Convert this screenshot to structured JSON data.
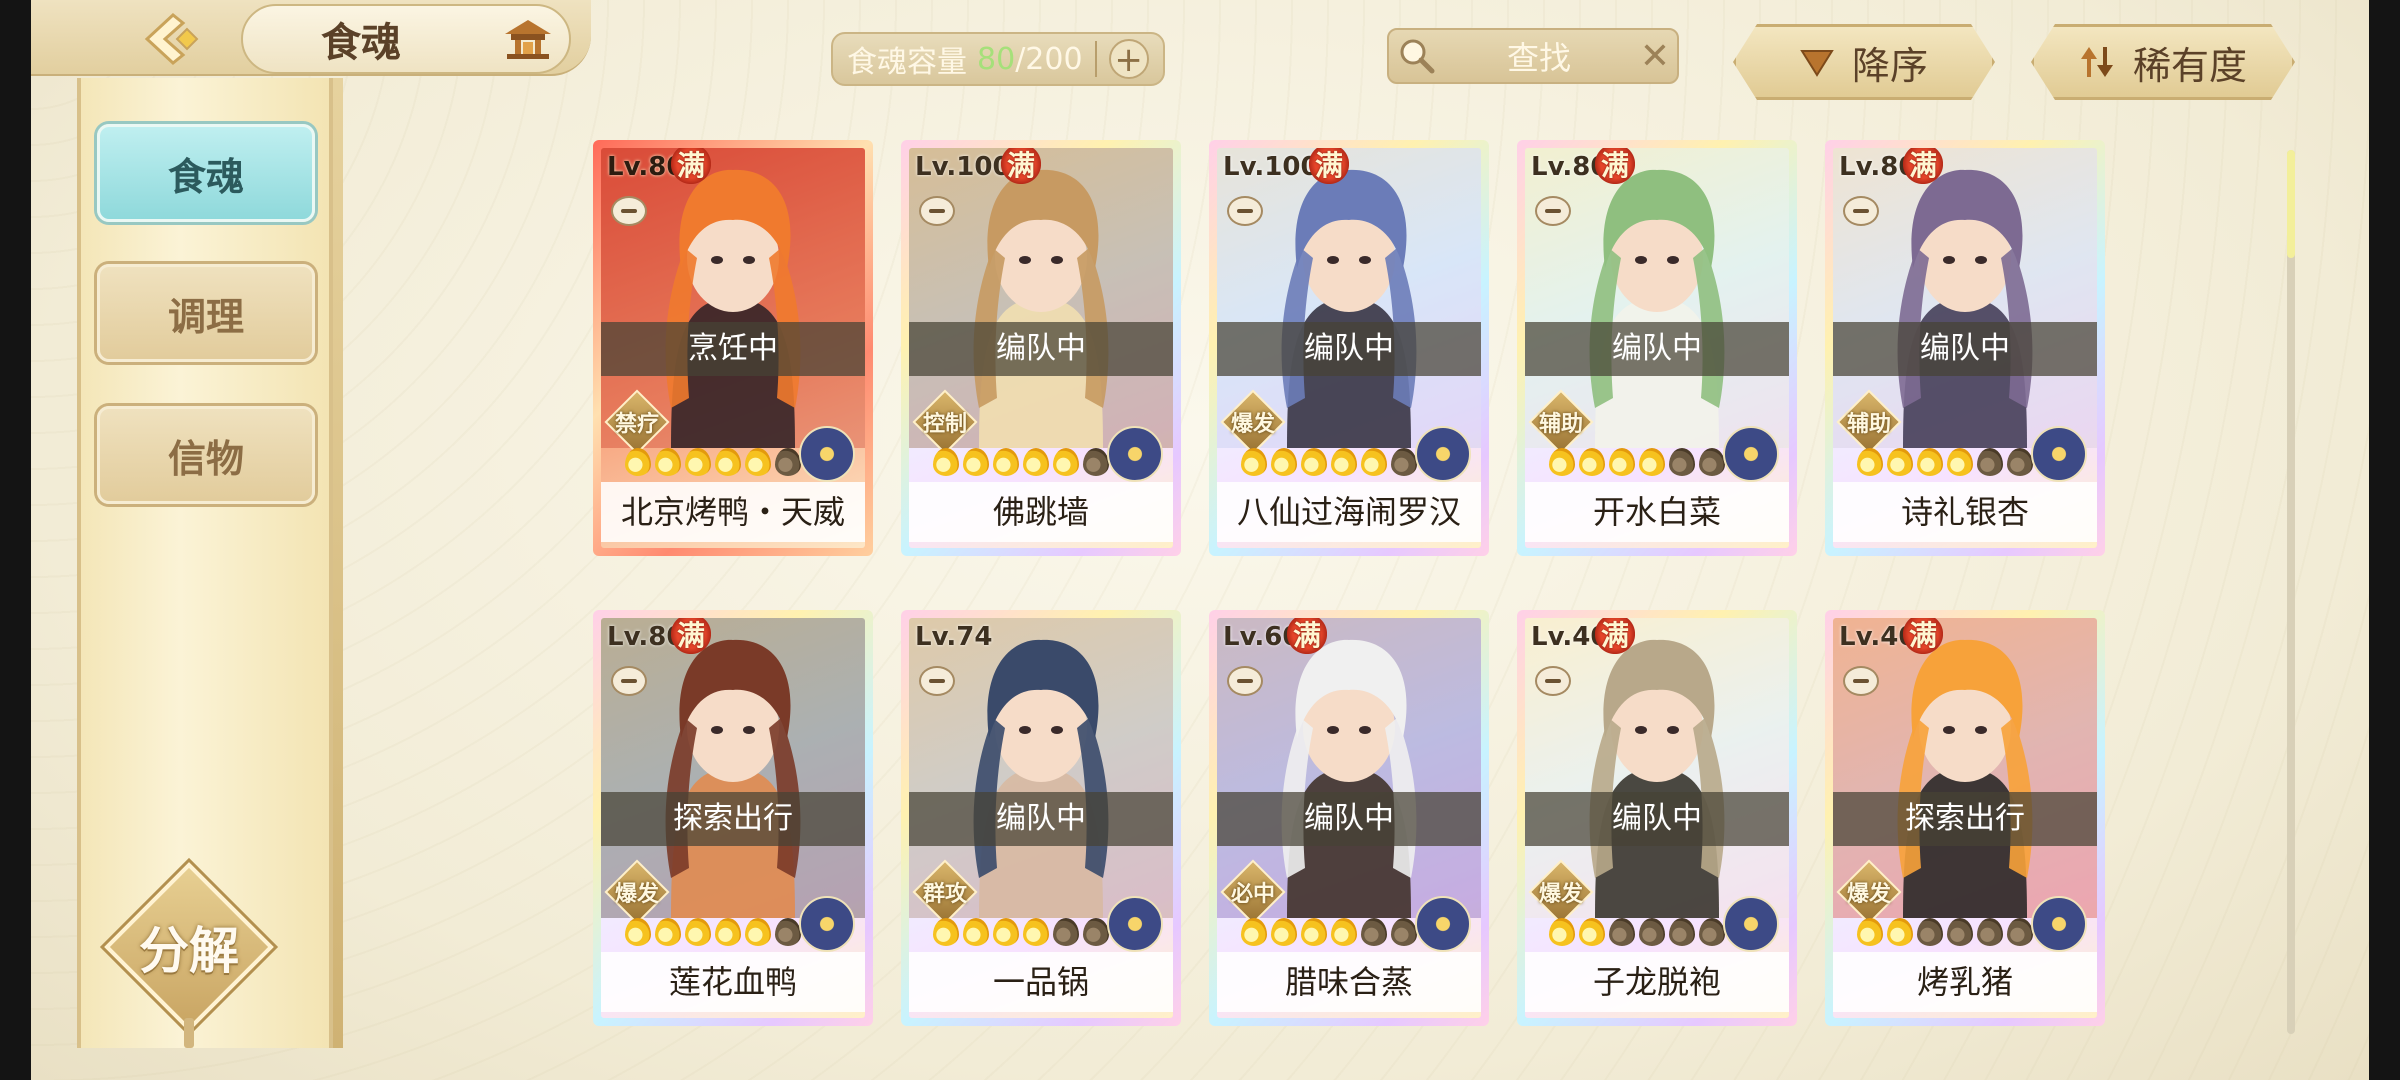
{
  "header": {
    "title": "食魂",
    "capacity_label": "食魂容量",
    "capacity_current": "80",
    "capacity_max": "200",
    "capacity_plus": "+",
    "search_placeholder": "查找",
    "search_clear": "✕",
    "sort_order_label": "降序",
    "sort_rarity_label": "稀有度"
  },
  "sidebar": {
    "items": [
      {
        "label": "食魂",
        "active": true
      },
      {
        "label": "调理",
        "active": false
      },
      {
        "label": "信物",
        "active": false
      }
    ],
    "decompose_label": "分解"
  },
  "max_badge_text": "满",
  "cards": [
    {
      "level": "Lv.80",
      "max": true,
      "status": "烹饪中",
      "role": "禁疗",
      "stars_filled": 5,
      "name": "北京烤鸭・天威",
      "frame": "red"
    },
    {
      "level": "Lv.100",
      "max": true,
      "status": "编队中",
      "role": "控制",
      "stars_filled": 5,
      "name": "佛跳墙",
      "frame": "rainbow"
    },
    {
      "level": "Lv.100",
      "max": true,
      "status": "编队中",
      "role": "爆发",
      "stars_filled": 5,
      "name": "八仙过海闹罗汉",
      "frame": "rainbow"
    },
    {
      "level": "Lv.80",
      "max": true,
      "status": "编队中",
      "role": "辅助",
      "stars_filled": 4,
      "name": "开水白菜",
      "frame": "rainbow"
    },
    {
      "level": "Lv.80",
      "max": true,
      "status": "编队中",
      "role": "辅助",
      "stars_filled": 4,
      "name": "诗礼银杏",
      "frame": "rainbow"
    },
    {
      "level": "Lv.80",
      "max": true,
      "status": "探索出行",
      "role": "爆发",
      "stars_filled": 5,
      "name": "莲花血鸭",
      "frame": "rainbow"
    },
    {
      "level": "Lv.74",
      "max": false,
      "status": "编队中",
      "role": "群攻",
      "stars_filled": 4,
      "name": "一品锅",
      "frame": "rainbow"
    },
    {
      "level": "Lv.60",
      "max": true,
      "status": "编队中",
      "role": "必中",
      "stars_filled": 4,
      "name": "腊味合蒸",
      "frame": "rainbow"
    },
    {
      "level": "Lv.40",
      "max": true,
      "status": "编队中",
      "role": "爆发",
      "stars_filled": 2,
      "name": "子龙脱袍",
      "frame": "rainbow"
    },
    {
      "level": "Lv.40",
      "max": true,
      "status": "探索出行",
      "role": "爆发",
      "stars_filled": 2,
      "name": "烤乳猪",
      "frame": "rainbow"
    }
  ],
  "colors": {
    "capacity_current": "#a6e07a",
    "active_tab": "#8fd9db",
    "max_badge": "#e5452a"
  }
}
